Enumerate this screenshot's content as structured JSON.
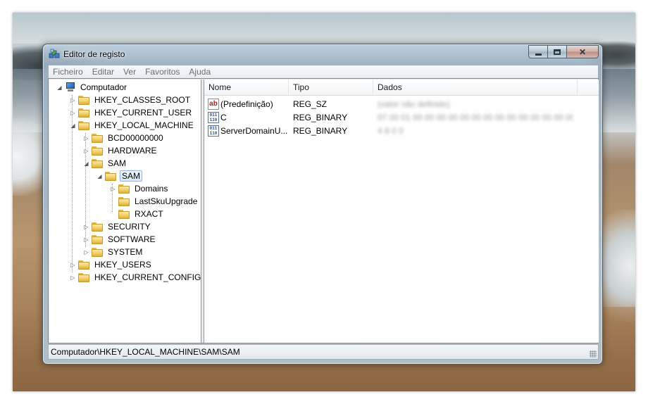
{
  "window": {
    "title": "Editor de registo",
    "minimize_symbol": "",
    "maximize_symbol": "",
    "close_symbol": "✕"
  },
  "menu": [
    {
      "label": "Ficheiro"
    },
    {
      "label": "Editar"
    },
    {
      "label": "Ver"
    },
    {
      "label": "Favoritos"
    },
    {
      "label": "Ajuda"
    }
  ],
  "tree": {
    "root": "Computador",
    "nodes": [
      {
        "label": "HKEY_CLASSES_ROOT",
        "expanded": false
      },
      {
        "label": "HKEY_CURRENT_USER",
        "expanded": false
      },
      {
        "label": "HKEY_LOCAL_MACHINE",
        "expanded": true
      },
      {
        "label": "BCD00000000",
        "expanded": false
      },
      {
        "label": "HARDWARE",
        "expanded": false
      },
      {
        "label": "SAM",
        "expanded": true
      },
      {
        "label": "SAM",
        "expanded": true,
        "selected": true
      },
      {
        "label": "Domains",
        "expanded": false
      },
      {
        "label": "LastSkuUpgrade",
        "expanded": false
      },
      {
        "label": "RXACT",
        "expanded": false
      },
      {
        "label": "SECURITY",
        "expanded": false
      },
      {
        "label": "SOFTWARE",
        "expanded": false
      },
      {
        "label": "SYSTEM",
        "expanded": false
      },
      {
        "label": "HKEY_USERS",
        "expanded": false
      },
      {
        "label": "HKEY_CURRENT_CONFIG",
        "expanded": false
      }
    ]
  },
  "list": {
    "columns": [
      "Nome",
      "Tipo",
      "Dados"
    ],
    "rows": [
      {
        "name": "(Predefinição)",
        "type": "REG_SZ",
        "icon": "string-value-icon",
        "data": "(valor não definido)"
      },
      {
        "name": "C",
        "type": "REG_BINARY",
        "icon": "binary-value-icon",
        "data": "07 00 01 00 00 00 00 00 00 00 00 00 00 00 00 00 00 00 00 00 00 00 00 ..."
      },
      {
        "name": "ServerDomainU...",
        "type": "REG_BINARY",
        "icon": "binary-value-icon",
        "data": "4 8 0 0"
      }
    ]
  },
  "status": {
    "path": "Computador\\HKEY_LOCAL_MACHINE\\SAM\\SAM"
  },
  "icons": {
    "string_icon_text": "ab",
    "binary_icon_text": "011\n110",
    "collapsed_glyph": "▷",
    "expanded_glyph": "◢"
  },
  "colors": {
    "accent": "#98b8e4",
    "string_icon": "#c2161a",
    "binary_icon": "#2c4a8c"
  }
}
